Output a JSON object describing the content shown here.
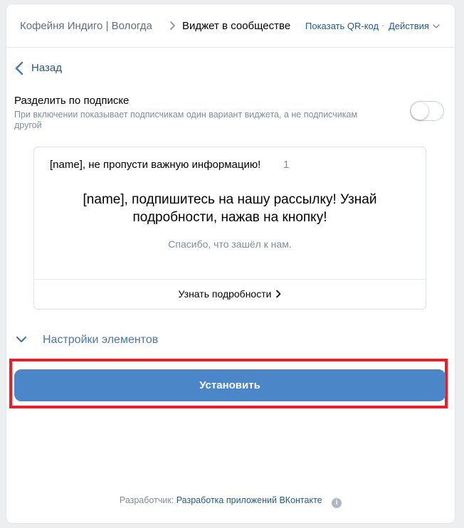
{
  "header": {
    "community": "Кофейня Индиго | Вологда",
    "current": "Виджет в сообществе",
    "qr_link": "Показать QR-код",
    "separator": "·",
    "actions": "Действия"
  },
  "back": {
    "label": "Назад"
  },
  "split": {
    "title": "Разделить по подписке",
    "description": "При включении показывает подписчикам один вариант виджета, а не подписчикам другой",
    "enabled": false
  },
  "widget": {
    "title": "[name], не пропусти важную информацию!",
    "count": "1",
    "text": "[name], подпишитесь на нашу рассылку! Узнай подробности, нажав на кнопку!",
    "subtext": "Спасибо, что зашёл к нам.",
    "button_label": "Узнать подробности"
  },
  "settings": {
    "label": "Настройки элементов"
  },
  "install": {
    "label": "Установить"
  },
  "footer": {
    "developer_label": "Разработчик:",
    "developer_link": "Разработка приложений ВКонтакте",
    "info_glyph": "i"
  },
  "colors": {
    "link": "#2a5885",
    "button": "#4a86c8",
    "highlight": "#e3202b",
    "muted": "#818c99"
  }
}
